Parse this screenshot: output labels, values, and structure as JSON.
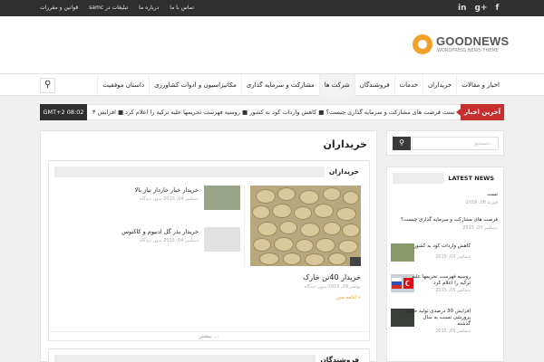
{
  "topbar": {
    "social": [
      "in",
      "g+",
      "f"
    ],
    "menu": [
      "تماس با ما",
      "درباره ما",
      "تبلیغات در samc",
      "قوانین و مقررات"
    ]
  },
  "logo": {
    "name": "GOODNEWS",
    "tagline": "WORDPRESS NEWS THEME"
  },
  "nav": {
    "items": [
      "اخبار و مقالات",
      "خریداران",
      "خدمات",
      "فروشندگان",
      "شرکت ها",
      "مشارکت و سرمایه گذاری",
      "مکانیزاسیون و ادوات کشاورزی",
      "داستان موفقیت"
    ],
    "active_index": 4
  },
  "ticker": {
    "label": "آخرین اخبار",
    "time": "GMT+2 08:02",
    "text": "تست  فرصت های مشارکت و سرمایه گذاری چیست؟  ■  کاهش واردات کود به کشور  ■  روسیه فهرست تحریمها علیه ترکیه را اعلام کرد  ■  افزایش ۳"
  },
  "main": {
    "page_title": "خریداران",
    "section_title": "خریداران",
    "featured": {
      "title": "خریدار 40تن خارک",
      "meta": "نوامبر 29, 2015  بدون دیدگاه",
      "more": "ادامه متن «"
    },
    "list": [
      {
        "title": "خریدار خیار خارداز تیاز بالا",
        "meta": "دسامبر 04, 2015   بدون دیدگاه"
      },
      {
        "title": "خریدار بذر گل ادنیوم و کاکتوس",
        "meta": "دسامبر 04, 2015   بدون دیدگاه"
      }
    ],
    "pager": "بیشتر ...",
    "section2_title": "فروشندگان"
  },
  "sidebar": {
    "search_placeholder": "جستجو...",
    "latest_title": "LATEST NEWS",
    "items": [
      {
        "title": "تست",
        "meta": "فوریه 08, 2016"
      },
      {
        "title": "فرصت های مشارکت و سرمایه گذاری چیست؟",
        "meta": "دسامبر 05, 2015"
      },
      {
        "title": "کاهش واردات کود به کشور",
        "meta": "دسامبر 05, 2015"
      },
      {
        "title": "روسیه فهرست تحریمها علیه",
        "title2": "ترکیه را اعلام کرد",
        "meta": "دسامبر 05, 2015"
      },
      {
        "title": "افزایش 30 درصدی تولید خاویار",
        "title2": "پرورشی نسبت به سال",
        "title3": "گذشته",
        "meta": "دسامبر 05, 2015"
      }
    ]
  },
  "colors": {
    "accent": "#c62d2d",
    "logo": "#f2a02c",
    "topbar": "#2f2f2f",
    "more": "#e39b1b"
  }
}
